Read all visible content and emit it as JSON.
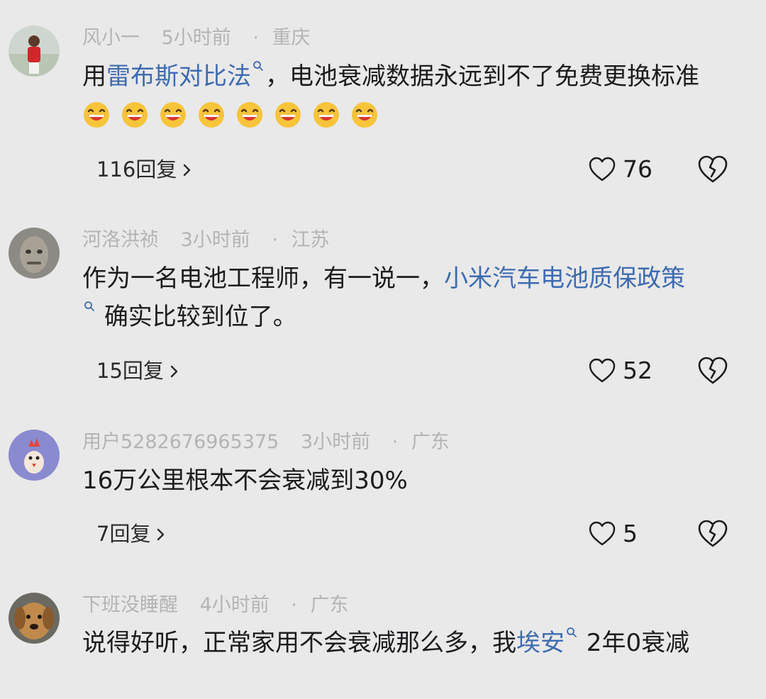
{
  "comments": [
    {
      "username": "风小一",
      "time": "5小时前",
      "location": "重庆",
      "text_before": "用",
      "link_text": "雷布斯对比法",
      "text_after": "，电池衰减数据永远到不了免费更换标准",
      "emoji": [
        "laugh-emoji",
        "laugh-emoji",
        "laugh-emoji",
        "laugh-emoji",
        "laugh-emoji",
        "laugh-emoji",
        "laugh-emoji",
        "laugh-emoji"
      ],
      "replies": "116回复",
      "likes": "76"
    },
    {
      "username": "河洛洪祯",
      "time": "3小时前",
      "location": "江苏",
      "text_before": "作为一名电池工程师，有一说一，",
      "link_text": "小米汽车电池质保政策",
      "text_after": "确实比较到位了。",
      "replies": "15回复",
      "likes": "52"
    },
    {
      "username": "用户5282676965375",
      "time": "3小时前",
      "location": "广东",
      "text": "16万公里根本不会衰减到30%",
      "replies": "7回复",
      "likes": "5"
    },
    {
      "username": "下班没睡醒",
      "time": "4小时前",
      "location": "广东",
      "text_before": "说得好听，正常家用不会衰减那么多，我",
      "link_text": "埃安",
      "text_after": " 2年0衰减"
    }
  ],
  "separator": "·",
  "icons": {
    "like": "heart-outline-icon",
    "dislike": "broken-heart-icon",
    "search": "search-icon",
    "chevron": "chevron-right-icon"
  },
  "colors": {
    "background": "#e9e9ea",
    "link": "#3e6bb0",
    "meta": "#b4b4b6"
  }
}
